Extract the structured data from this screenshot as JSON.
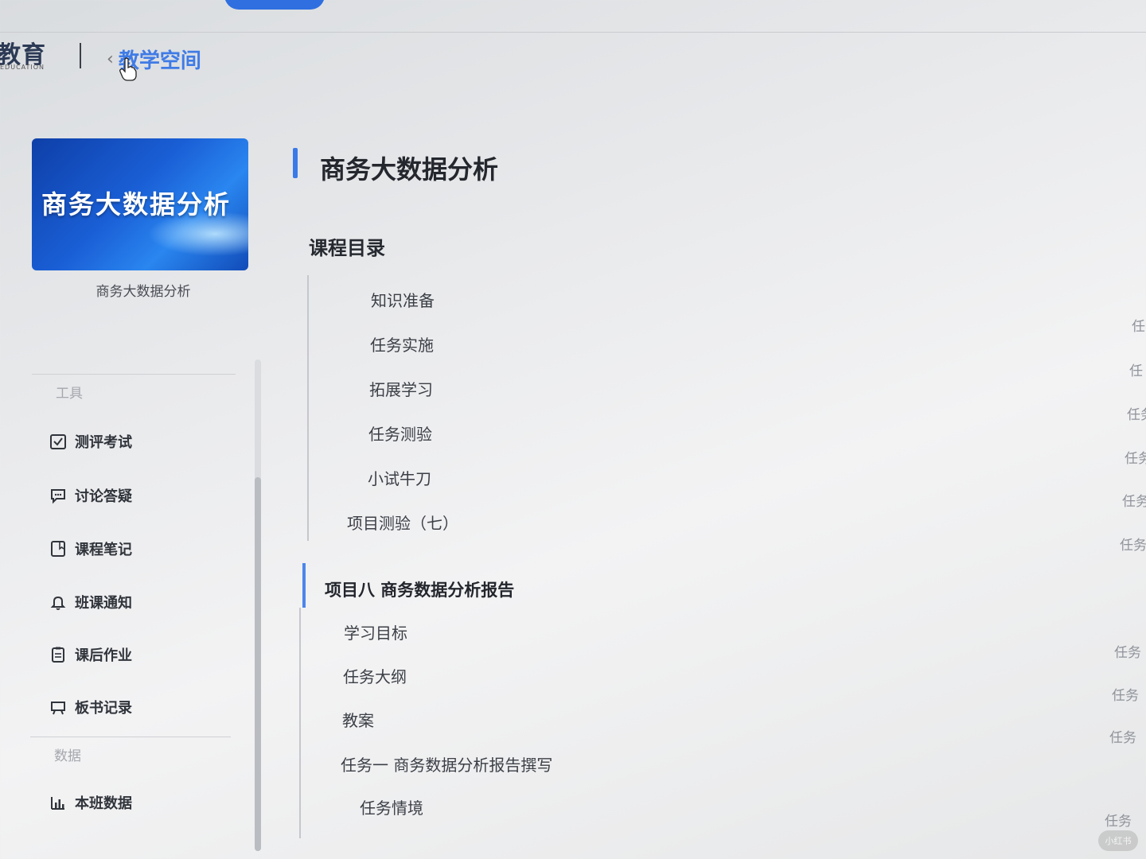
{
  "header": {
    "logo_text": "教育",
    "logo_subtext": "EDUCATION",
    "back_label": "教学空间"
  },
  "course": {
    "cover_title": "商务大数据分析",
    "name": "商务大数据分析"
  },
  "sidebar": {
    "tools_section": "工具",
    "data_section": "数据",
    "items": [
      {
        "label": "测评考试",
        "icon": "exam-check-icon"
      },
      {
        "label": "讨论答疑",
        "icon": "chat-icon"
      },
      {
        "label": "课程笔记",
        "icon": "note-icon"
      },
      {
        "label": "班课通知",
        "icon": "bell-icon"
      },
      {
        "label": "课后作业",
        "icon": "clipboard-icon"
      },
      {
        "label": "板书记录",
        "icon": "board-icon"
      }
    ],
    "data_items": [
      {
        "label": "本班数据",
        "icon": "bar-chart-icon"
      }
    ]
  },
  "main": {
    "title": "商务大数据分析",
    "catalog_title": "课程目录",
    "prev_items": [
      "知识准备",
      "任务实施",
      "拓展学习",
      "任务测验",
      "小试牛刀"
    ],
    "prev_quiz": "项目测验（七）",
    "chapter": "项目八 商务数据分析报告",
    "chapter_items": [
      "学习目标",
      "任务大纲",
      "教案",
      "任务一 商务数据分析报告撰写"
    ],
    "sub_item": "任务情境"
  },
  "right_column": [
    "任",
    "任",
    "任务",
    "任务",
    "任务",
    "任务",
    "任务",
    "任务",
    "任务",
    "任务"
  ],
  "watermark": "小红书",
  "colors": {
    "accent": "#2f6fe0",
    "cover_dark": "#0e3fa8",
    "cover_light": "#2a86f0"
  }
}
